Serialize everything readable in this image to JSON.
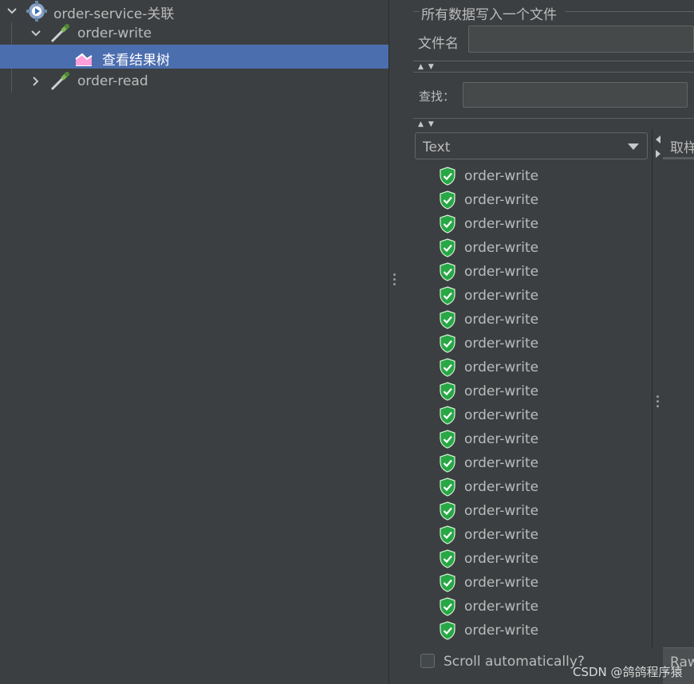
{
  "tree": {
    "nodes": [
      {
        "label": "order-service-关联",
        "icon": "gear-icon",
        "expanded": true
      },
      {
        "label": "order-write",
        "icon": "pipette-icon",
        "expanded": true
      },
      {
        "label": "查看结果树",
        "icon": "chart-icon",
        "selected": true
      },
      {
        "label": "order-read",
        "icon": "pipette-icon",
        "expanded": false
      }
    ]
  },
  "file_section": {
    "legend": "所有数据写入一个文件",
    "filename_label": "文件名",
    "filename_value": ""
  },
  "search": {
    "label": "查找：",
    "value": ""
  },
  "renderer_select": {
    "selected": "Text"
  },
  "results": [
    "order-write",
    "order-write",
    "order-write",
    "order-write",
    "order-write",
    "order-write",
    "order-write",
    "order-write",
    "order-write",
    "order-write",
    "order-write",
    "order-write",
    "order-write",
    "order-write",
    "order-write",
    "order-write",
    "order-write",
    "order-write",
    "order-write",
    "order-write"
  ],
  "sampler_tab_label": "取样",
  "raw_tab_label": "Raw",
  "scroll_auto_label": "Scroll automatically?",
  "watermark": "CSDN @鸽鸽程序猿",
  "colors": {
    "background": "#3c3f41",
    "selection": "#4b6eaf",
    "success_shield": "#28a745"
  }
}
